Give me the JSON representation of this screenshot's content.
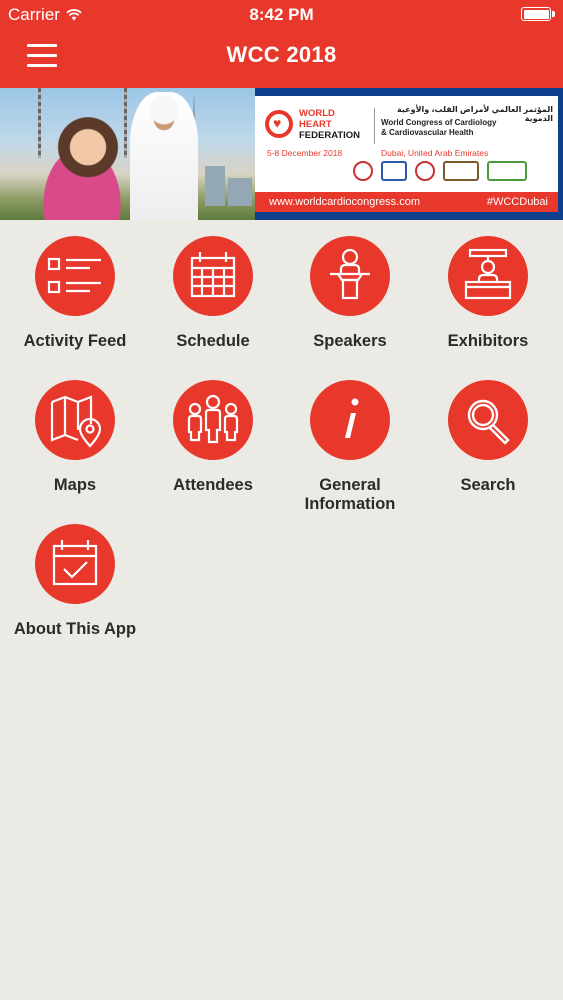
{
  "status_bar": {
    "carrier": "Carrier",
    "time": "8:42 PM"
  },
  "nav": {
    "title": "WCC 2018",
    "menu_icon": "hamburger-menu-icon"
  },
  "banner": {
    "org_line1": "WORLD",
    "org_line2": "HEART",
    "org_line3": "FEDERATION",
    "arabic_title": "المؤتمر العالمي لأمراض القلب، والأوعية الدموية",
    "congress_line1": "World Congress of Cardiology",
    "congress_line2": "& Cardiovascular Health",
    "dates": "5-8 December 2018",
    "location": "Dubai, United Arab Emirates",
    "website": "www.worldcardiocongress.com",
    "hashtag": "#WCCDubai"
  },
  "menu": {
    "accent_color": "#E8382C",
    "items": [
      {
        "label": "Activity Feed",
        "icon": "list-icon"
      },
      {
        "label": "Schedule",
        "icon": "calendar-grid-icon"
      },
      {
        "label": "Speakers",
        "icon": "podium-speaker-icon"
      },
      {
        "label": "Exhibitors",
        "icon": "booth-icon"
      },
      {
        "label": "Maps",
        "icon": "map-pin-icon"
      },
      {
        "label": "Attendees",
        "icon": "people-icon"
      },
      {
        "label": "General Information",
        "icon": "info-icon"
      },
      {
        "label": "Search",
        "icon": "magnifier-icon"
      },
      {
        "label": "About This App",
        "icon": "calendar-check-icon"
      }
    ]
  }
}
